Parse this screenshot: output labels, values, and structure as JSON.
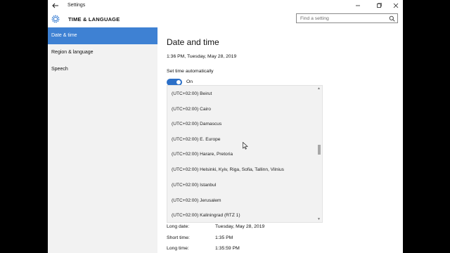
{
  "window": {
    "title": "Settings"
  },
  "header": {
    "section_title": "TIME & LANGUAGE",
    "search_placeholder": "Find a setting"
  },
  "sidebar": {
    "items": [
      {
        "label": "Date & time",
        "active": true
      },
      {
        "label": "Region & language",
        "active": false
      },
      {
        "label": "Speech",
        "active": false
      }
    ]
  },
  "main": {
    "title": "Date and time",
    "current_time": "1:36 PM, Tuesday, May 28, 2019",
    "auto_time_label": "Set time automatically",
    "auto_time_state": "On",
    "timezones": [
      "(UTC+02:00) Beirut",
      "(UTC+02:00) Cairo",
      "(UTC+02:00) Damascus",
      "(UTC+02:00) E. Europe",
      "(UTC+02:00) Harare, Pretoria",
      "(UTC+02:00) Helsinki, Kyiv, Riga, Sofia, Tallinn, Vilnius",
      "(UTC+02:00) Istanbul",
      "(UTC+02:00) Jerusalem",
      "(UTC+02:00) Kaliningrad (RTZ 1)"
    ],
    "formats": [
      {
        "label": "Long date:",
        "value": "Tuesday, May 28, 2019"
      },
      {
        "label": "Short time:",
        "value": "1:35 PM"
      },
      {
        "label": "Long time:",
        "value": "1:35:59 PM"
      }
    ]
  },
  "colors": {
    "accent": "#3e81d3",
    "toggle_on": "#2b6fc7",
    "sidebar_bg": "#f2f2f2"
  },
  "icons": [
    "back-arrow-icon",
    "minimize-icon",
    "maximize-icon",
    "close-icon",
    "gear-icon",
    "search-icon"
  ]
}
